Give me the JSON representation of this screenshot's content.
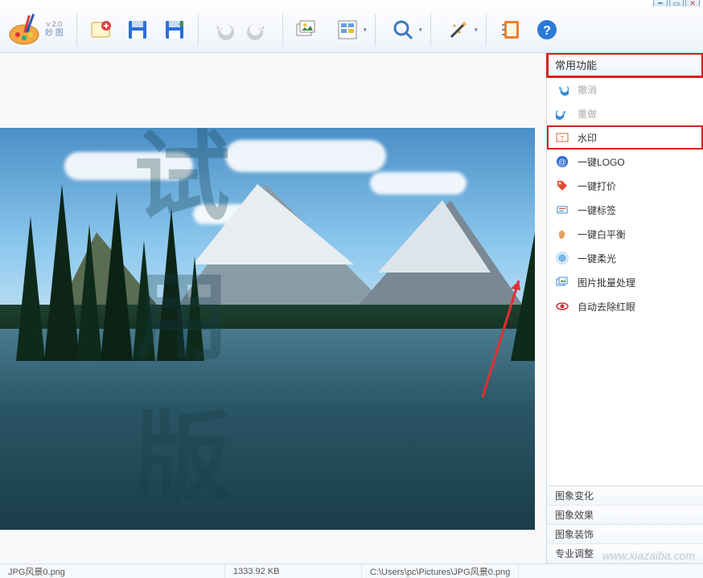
{
  "app": {
    "version": "v 2.0",
    "name": "妙 图"
  },
  "toolbar": {},
  "sidebar": {
    "header": "常用功能",
    "items": [
      {
        "label": "撤消",
        "icon": "undo",
        "disabled": true
      },
      {
        "label": "重做",
        "icon": "redo",
        "disabled": true
      },
      {
        "label": "水印",
        "icon": "watermark",
        "highlight": true
      },
      {
        "label": "一键LOGO",
        "icon": "logo"
      },
      {
        "label": "一键打价",
        "icon": "price"
      },
      {
        "label": "一键标签",
        "icon": "label"
      },
      {
        "label": "一键白平衡",
        "icon": "whitebalance"
      },
      {
        "label": "一键柔光",
        "icon": "softlight"
      },
      {
        "label": "图片批量处理",
        "icon": "batch"
      },
      {
        "label": "自动去除红眼",
        "icon": "redeye"
      }
    ]
  },
  "bottom_panels": [
    "图象变化",
    "图象效果",
    "图象装饰",
    "专业调整"
  ],
  "status": {
    "filename": "JPG风景0.png",
    "filesize": "1333.92 KB",
    "filepath": "C:\\Users\\pc\\Pictures\\JPG风景0.png"
  },
  "canvas": {
    "watermark_text": "试 用 版"
  },
  "footer_watermark": "www.xiazaiba.com"
}
